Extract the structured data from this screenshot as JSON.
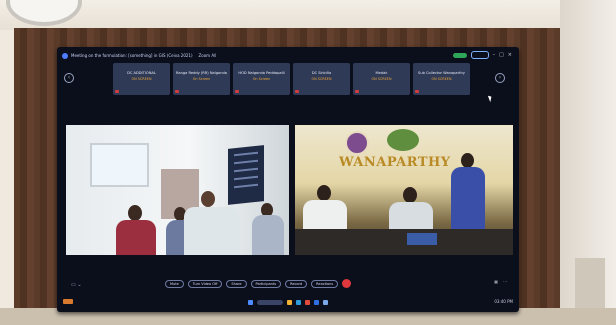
{
  "screen": {
    "window_title": "Meeting on the formulation: [something] in GIS (Ceiva 2021)",
    "window_subtitle": "Zoom All",
    "participants": [
      {
        "name": "DC ADDITIONAL",
        "status": "ON SCREEN"
      },
      {
        "name": "Ranga Reddy (RR) Nalgonda",
        "status": "On Screen"
      },
      {
        "name": "HOD Nalgonda Peddapalli",
        "status": "On Screen"
      },
      {
        "name": "DC Siricilla",
        "status": "ON SCREEN"
      },
      {
        "name": "Medak",
        "status": "ON SCREEN"
      },
      {
        "name": "Sub Collector Wanaparthy",
        "status": "ON SCREEN"
      }
    ],
    "right_video_banner": "WANAPARTHY",
    "toolbar": [
      "Mute",
      "Turn Video Off",
      "Share",
      "Participants",
      "Record",
      "Reactions"
    ],
    "clock_text": "03:40 PM"
  }
}
